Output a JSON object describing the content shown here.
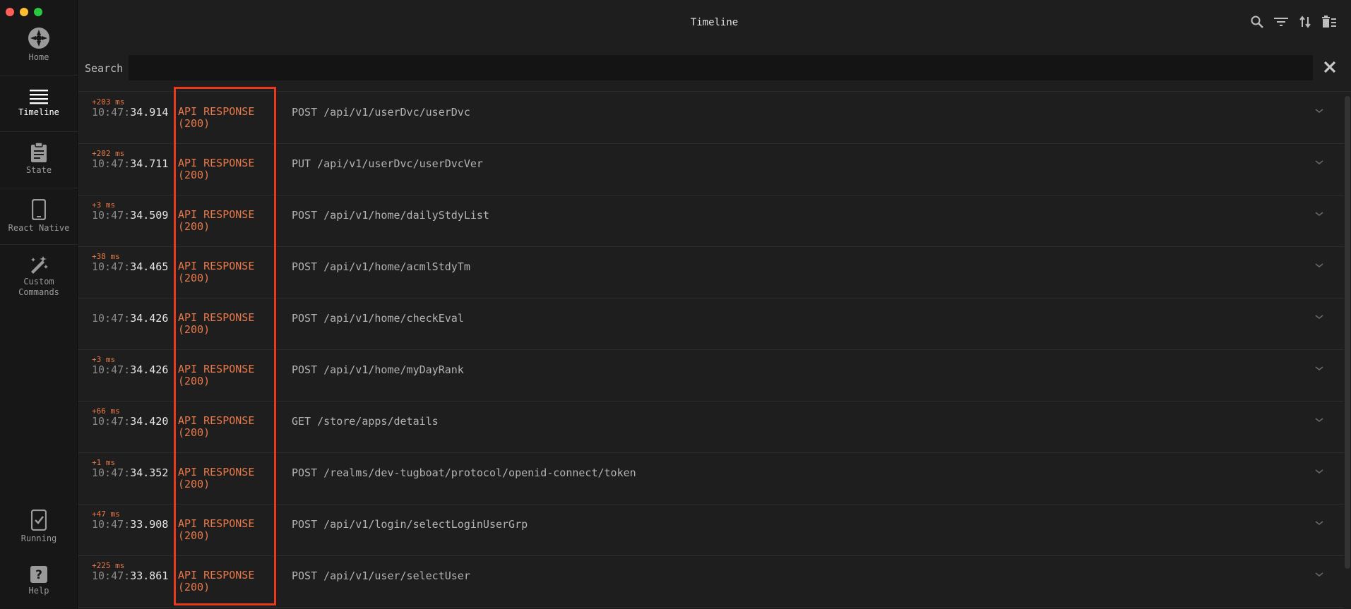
{
  "header": {
    "title": "Timeline"
  },
  "search": {
    "label": "Search",
    "value": "",
    "placeholder": ""
  },
  "sidebar": {
    "items": [
      {
        "label": "Home",
        "icon": "home-icon"
      },
      {
        "label": "Timeline",
        "icon": "timeline-icon"
      },
      {
        "label": "State",
        "icon": "clipboard-icon"
      },
      {
        "label": "React Native",
        "icon": "phone-icon"
      },
      {
        "label": "Custom Commands",
        "icon": "magic-wand-icon"
      },
      {
        "label": "Running",
        "icon": "running-icon"
      },
      {
        "label": "Help",
        "icon": "help-icon"
      }
    ]
  },
  "colors": {
    "accent": "#e8794a",
    "highlight": "#e8391c"
  },
  "timeline": [
    {
      "delta": "+203 ms",
      "time_prefix": "10:47:",
      "time_sec": "34.914",
      "type": "API RESPONSE",
      "status": "(200)",
      "request": "POST /api/v1/userDvc/userDvc"
    },
    {
      "delta": "+202 ms",
      "time_prefix": "10:47:",
      "time_sec": "34.711",
      "type": "API RESPONSE",
      "status": "(200)",
      "request": "PUT /api/v1/userDvc/userDvcVer"
    },
    {
      "delta": "+3 ms",
      "time_prefix": "10:47:",
      "time_sec": "34.509",
      "type": "API RESPONSE",
      "status": "(200)",
      "request": "POST /api/v1/home/dailyStdyList"
    },
    {
      "delta": "+38 ms",
      "time_prefix": "10:47:",
      "time_sec": "34.465",
      "type": "API RESPONSE",
      "status": "(200)",
      "request": "POST /api/v1/home/acmlStdyTm"
    },
    {
      "delta": "",
      "time_prefix": "10:47:",
      "time_sec": "34.426",
      "type": "API RESPONSE",
      "status": "(200)",
      "request": "POST /api/v1/home/checkEval"
    },
    {
      "delta": "+3 ms",
      "time_prefix": "10:47:",
      "time_sec": "34.426",
      "type": "API RESPONSE",
      "status": "(200)",
      "request": "POST /api/v1/home/myDayRank"
    },
    {
      "delta": "+66 ms",
      "time_prefix": "10:47:",
      "time_sec": "34.420",
      "type": "API RESPONSE",
      "status": "(200)",
      "request": "GET /store/apps/details"
    },
    {
      "delta": "+1 ms",
      "time_prefix": "10:47:",
      "time_sec": "34.352",
      "type": "API RESPONSE",
      "status": "(200)",
      "request": "POST /realms/dev-tugboat/protocol/openid-connect/token"
    },
    {
      "delta": "+47 ms",
      "time_prefix": "10:47:",
      "time_sec": "33.908",
      "type": "API RESPONSE",
      "status": "(200)",
      "request": "POST /api/v1/login/selectLoginUserGrp"
    },
    {
      "delta": "+225 ms",
      "time_prefix": "10:47:",
      "time_sec": "33.861",
      "type": "API RESPONSE",
      "status": "(200)",
      "request": "POST /api/v1/user/selectUser"
    }
  ]
}
